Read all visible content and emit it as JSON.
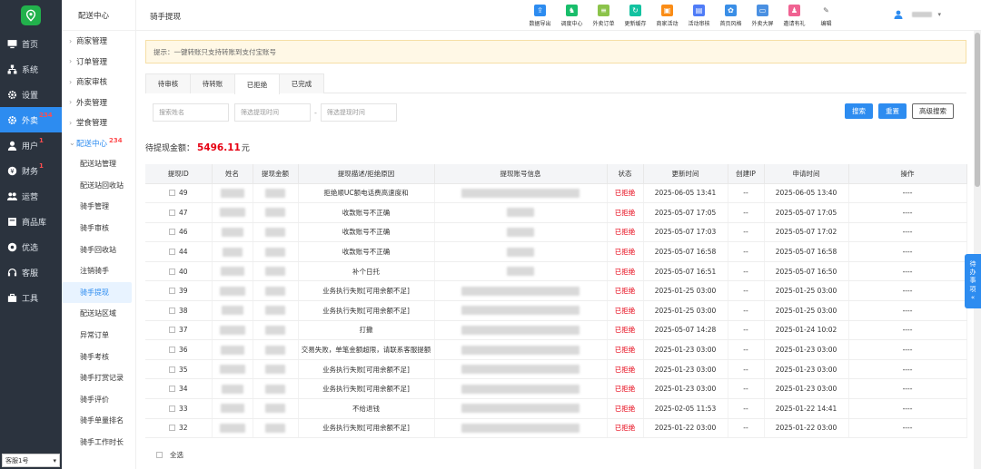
{
  "sidebar": {
    "items": [
      {
        "label": "首页",
        "icon": "monitor-icon",
        "badge": ""
      },
      {
        "label": "系统",
        "icon": "sitemap-icon",
        "badge": ""
      },
      {
        "label": "设置",
        "icon": "gear-icon",
        "badge": ""
      },
      {
        "label": "外卖",
        "icon": "gear-icon",
        "badge": "234",
        "active": true
      },
      {
        "label": "用户",
        "icon": "user-icon",
        "badge": "1"
      },
      {
        "label": "财务",
        "icon": "coin-icon",
        "badge": "1"
      },
      {
        "label": "运营",
        "icon": "people-icon",
        "badge": ""
      },
      {
        "label": "商品库",
        "icon": "box-icon",
        "badge": ""
      },
      {
        "label": "优选",
        "icon": "circle-icon",
        "badge": ""
      },
      {
        "label": "客服",
        "icon": "headset-icon",
        "badge": ""
      },
      {
        "label": "工具",
        "icon": "toolbox-icon",
        "badge": ""
      }
    ],
    "store_select": "客服1号"
  },
  "subnav": {
    "header": "配送中心",
    "groups": [
      {
        "label": "商家管理"
      },
      {
        "label": "订单管理"
      },
      {
        "label": "商家审核"
      },
      {
        "label": "外卖管理"
      },
      {
        "label": "堂食管理"
      }
    ],
    "open_group": {
      "label": "配送中心",
      "badge": "234"
    },
    "items": [
      "配送站管理",
      "配送站回收站",
      "骑手管理",
      "骑手审核",
      "骑手回收站",
      "注销骑手",
      "骑手提现",
      "配送站区域",
      "异常订单",
      "骑手考核",
      "骑手打赏记录",
      "骑手评价",
      "骑手单量排名",
      "骑手工作时长"
    ]
  },
  "topbar": {
    "title": "骑手提现",
    "tools": [
      {
        "label": "数据导出",
        "color": "#2d8cf0",
        "glyph": "⇪"
      },
      {
        "label": "调度中心",
        "color": "#19be6b",
        "glyph": "♞"
      },
      {
        "label": "外卖订单",
        "color": "#8bc34a",
        "glyph": "≡"
      },
      {
        "label": "更新缓存",
        "color": "#13c2a0",
        "glyph": "↻"
      },
      {
        "label": "商家活动",
        "color": "#fa8c16",
        "glyph": "▣"
      },
      {
        "label": "活动审核",
        "color": "#4f7cf7",
        "glyph": "▤"
      },
      {
        "label": "首页风格",
        "color": "#3a8ee6",
        "glyph": "✿"
      },
      {
        "label": "外卖大屏",
        "color": "#4a90e2",
        "glyph": "▭"
      },
      {
        "label": "邀请有礼",
        "color": "#f06292",
        "glyph": "♟"
      },
      {
        "label": "编辑",
        "color": "#ffffff",
        "glyph": "✎"
      }
    ]
  },
  "notice": "提示：一键转账只支持转账到支付宝账号",
  "tabs": [
    "待审核",
    "待转账",
    "已拒绝",
    "已完成"
  ],
  "active_tab": 2,
  "filters": {
    "name_placeholder": "搜索姓名",
    "start_placeholder": "筛选提现时间",
    "dash": "-",
    "end_placeholder": "筛选提现时间"
  },
  "buttons": {
    "search": "搜索",
    "reset": "重置",
    "advanced": "高级搜索"
  },
  "pending": {
    "label": "待提现金额：",
    "amount": "5496.11",
    "unit": "元"
  },
  "table": {
    "headers": [
      "提现ID",
      "姓名",
      "提现金额",
      "提现描述/拒绝原因",
      "提现账号信息",
      "状态",
      "更新时间",
      "创建IP",
      "申请时间",
      "操作"
    ],
    "rows": [
      {
        "id": "49",
        "reason": "拒绝顺UC额电话费高速度和",
        "status": "已拒绝",
        "updated": "2025-06-05 13:41",
        "ip": "--",
        "applied": "2025-06-05 13:40",
        "op": "----",
        "acct_w": 130
      },
      {
        "id": "47",
        "reason": "收款账号不正确",
        "status": "已拒绝",
        "updated": "2025-05-07 17:05",
        "ip": "--",
        "applied": "2025-05-07 17:05",
        "op": "----",
        "acct_w": 30
      },
      {
        "id": "46",
        "reason": "收款账号不正确",
        "status": "已拒绝",
        "updated": "2025-05-07 17:03",
        "ip": "--",
        "applied": "2025-05-07 17:02",
        "op": "----",
        "acct_w": 30
      },
      {
        "id": "44",
        "reason": "收款账号不正确",
        "status": "已拒绝",
        "updated": "2025-05-07 16:58",
        "ip": "--",
        "applied": "2025-05-07 16:58",
        "op": "----",
        "acct_w": 30
      },
      {
        "id": "40",
        "reason": "补个日托",
        "status": "已拒绝",
        "updated": "2025-05-07 16:51",
        "ip": "--",
        "applied": "2025-05-07 16:50",
        "op": "----",
        "acct_w": 30
      },
      {
        "id": "39",
        "reason": "业务执行失败[可用余额不足]",
        "status": "已拒绝",
        "updated": "2025-01-25 03:00",
        "ip": "--",
        "applied": "2025-01-25 03:00",
        "op": "----",
        "acct_w": 130
      },
      {
        "id": "38",
        "reason": "业务执行失败[可用余额不足]",
        "status": "已拒绝",
        "updated": "2025-01-25 03:00",
        "ip": "--",
        "applied": "2025-01-25 03:00",
        "op": "----",
        "acct_w": 130
      },
      {
        "id": "37",
        "reason": "打撒",
        "status": "已拒绝",
        "updated": "2025-05-07 14:28",
        "ip": "--",
        "applied": "2025-01-24 10:02",
        "op": "----",
        "acct_w": 130
      },
      {
        "id": "36",
        "reason": "交易失败，单笔金额超限，请联系客服提额",
        "status": "已拒绝",
        "updated": "2025-01-23 03:00",
        "ip": "--",
        "applied": "2025-01-23 03:00",
        "op": "----",
        "acct_w": 130
      },
      {
        "id": "35",
        "reason": "业务执行失败[可用余额不足]",
        "status": "已拒绝",
        "updated": "2025-01-23 03:00",
        "ip": "--",
        "applied": "2025-01-23 03:00",
        "op": "----",
        "acct_w": 130
      },
      {
        "id": "34",
        "reason": "业务执行失败[可用余额不足]",
        "status": "已拒绝",
        "updated": "2025-01-23 03:00",
        "ip": "--",
        "applied": "2025-01-23 03:00",
        "op": "----",
        "acct_w": 130
      },
      {
        "id": "33",
        "reason": "不给退钱",
        "status": "已拒绝",
        "updated": "2025-02-05 11:53",
        "ip": "--",
        "applied": "2025-01-22 14:41",
        "op": "----",
        "acct_w": 130
      },
      {
        "id": "32",
        "reason": "业务执行失败[可用余额不足]",
        "status": "已拒绝",
        "updated": "2025-01-22 03:00",
        "ip": "--",
        "applied": "2025-01-22 03:00",
        "op": "----",
        "acct_w": 130
      }
    ]
  },
  "footer": {
    "select_all": "全选"
  },
  "todo": {
    "line1": "待",
    "line2": "办",
    "line3": "事",
    "line4": "项",
    "line5": "«"
  },
  "colors": {
    "primary": "#2d8cf0",
    "sidebar_bg": "#2b333e",
    "danger": "#e60012",
    "brand": "#22b14c"
  }
}
